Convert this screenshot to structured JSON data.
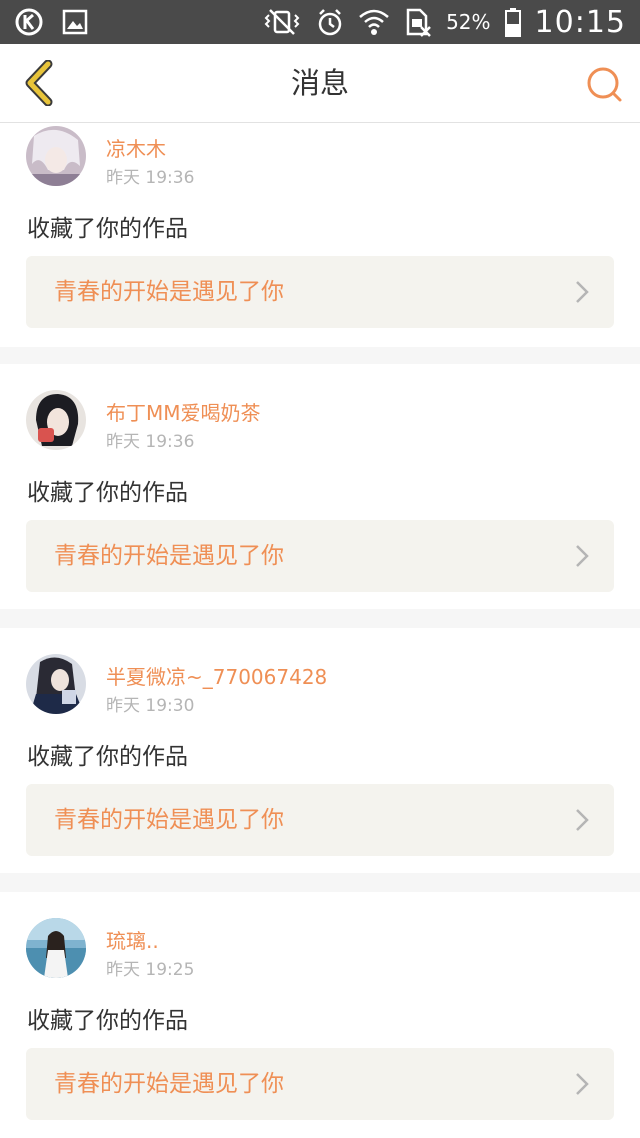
{
  "status_bar": {
    "battery_percent": "52%",
    "time": "10:15"
  },
  "nav": {
    "title": "消息"
  },
  "messages": [
    {
      "username": "凉木木",
      "time": "昨天 19:36",
      "action": "收藏了你的作品",
      "work_title": "青春的开始是遇见了你"
    },
    {
      "username": "布丁MM爱喝奶茶",
      "time": "昨天 19:36",
      "action": "收藏了你的作品",
      "work_title": "青春的开始是遇见了你"
    },
    {
      "username": "半夏微凉~_770067428",
      "time": "昨天 19:30",
      "action": "收藏了你的作品",
      "work_title": "青春的开始是遇见了你"
    },
    {
      "username": "琉璃..",
      "time": "昨天 19:25",
      "action": "收藏了你的作品",
      "work_title": "青春的开始是遇见了你"
    }
  ],
  "colors": {
    "accent": "#ef8f55",
    "back_arrow": "#e8c43a",
    "status_bar": "#4a4a4a"
  }
}
